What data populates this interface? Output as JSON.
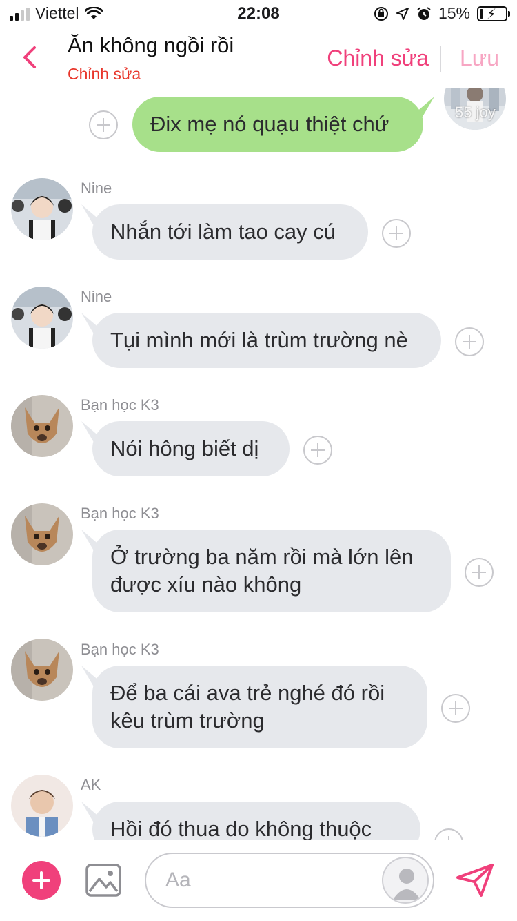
{
  "status_bar": {
    "carrier": "Viettel",
    "time": "22:08",
    "battery_percent": "15%",
    "battery_level": 0.15,
    "icons": [
      "signal-icon",
      "wifi-icon",
      "orientation-lock-icon",
      "location-icon",
      "alarm-icon",
      "battery-charging-icon"
    ]
  },
  "header": {
    "title": "Ăn không ngồi rồi",
    "subtitle": "Chỉnh sửa",
    "edit_label": "Chỉnh sửa",
    "save_label": "Lưu",
    "colors": {
      "accent": "#f0407b",
      "subtitle": "#e8362b",
      "save_disabled": "#f7a6c3"
    }
  },
  "messages": [
    {
      "direction": "outgoing",
      "text": "Đix mẹ nó quạu thiệt chứ",
      "avatar_watermark": "55 joy"
    },
    {
      "direction": "incoming",
      "sender": "Nine",
      "text": "Nhắn tới làm tao cay cú"
    },
    {
      "direction": "incoming",
      "sender": "Nine",
      "text": "Tụi mình mới là trùm trường nè"
    },
    {
      "direction": "incoming",
      "sender": "Bạn học K3",
      "text": "Nói hông biết dị"
    },
    {
      "direction": "incoming",
      "sender": "Bạn học K3",
      "text": "Ở trường ba năm rồi mà lớn lên được xíu nào không"
    },
    {
      "direction": "incoming",
      "sender": "Bạn học K3",
      "text": "Để ba cái ava trẻ nghé đó rồi kêu trùm trường"
    },
    {
      "direction": "incoming",
      "sender": "AK",
      "text": "Hồi đó thua do không thuộc"
    }
  ],
  "composer": {
    "placeholder": "Aa",
    "colors": {
      "outgoing_bubble": "#a7e08a",
      "incoming_bubble": "#e6e8ec",
      "send": "#f0407b"
    }
  }
}
